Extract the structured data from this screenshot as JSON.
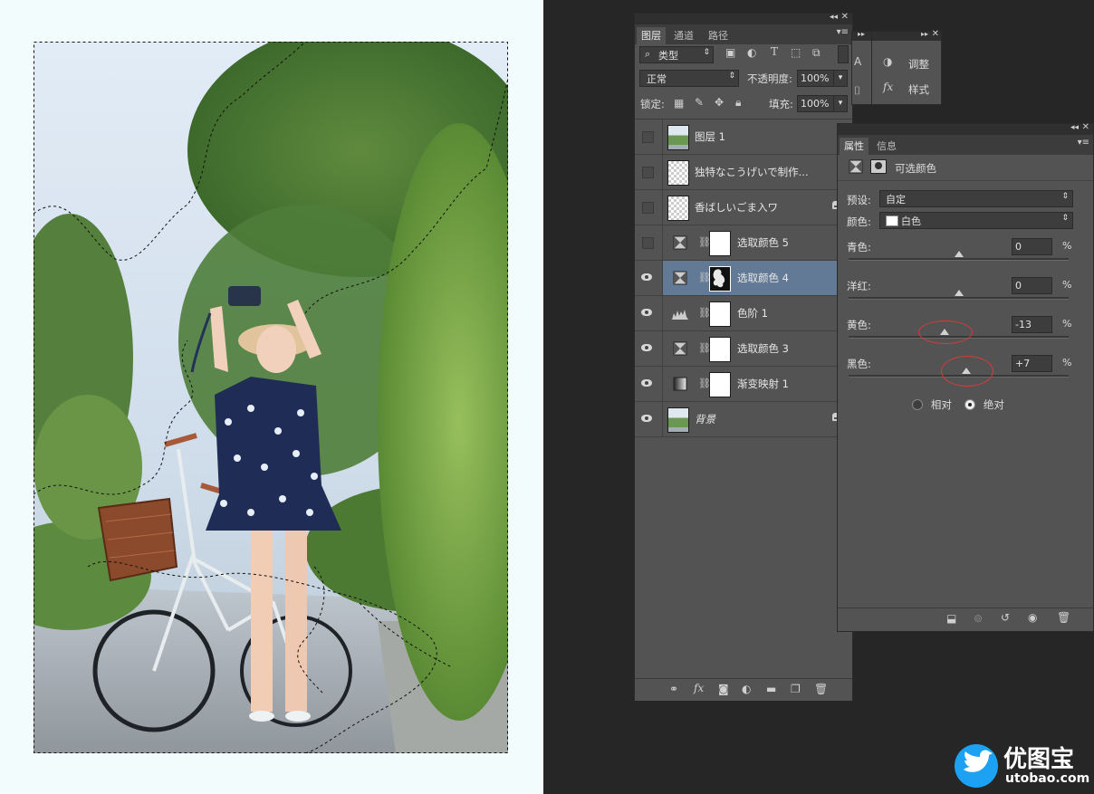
{
  "layers_panel": {
    "tabs": [
      "图层",
      "通道",
      "路径"
    ],
    "filter_kind": "类型",
    "blend_mode": "正常",
    "opacity_label": "不透明度:",
    "opacity_value": "100%",
    "lock_label": "锁定:",
    "fill_label": "填充:",
    "fill_value": "100%",
    "layers": [
      {
        "name": "图层 1",
        "visible": false,
        "thumb": "photo"
      },
      {
        "name": "独特なこうげいで制作...",
        "visible": false,
        "thumb": "checker"
      },
      {
        "name": "香ばしいごま入ワ",
        "visible": false,
        "thumb": "checker",
        "locked": true
      },
      {
        "name": "选取颜色 5",
        "visible": false,
        "thumb": "adjust-selective"
      },
      {
        "name": "选取颜色 4",
        "visible": true,
        "thumb": "adjust-selective",
        "selected": true
      },
      {
        "name": "色阶 1",
        "visible": true,
        "thumb": "adjust-levels"
      },
      {
        "name": "选取颜色 3",
        "visible": true,
        "thumb": "adjust-selective"
      },
      {
        "name": "渐变映射 1",
        "visible": true,
        "thumb": "adjust-gradient"
      },
      {
        "name": "背景",
        "visible": true,
        "thumb": "photo",
        "locked": true
      }
    ]
  },
  "adjust_panel": {
    "items": [
      {
        "label": "调整",
        "icon": "adjust-icon"
      },
      {
        "label": "样式",
        "icon": "fx-icon"
      }
    ]
  },
  "properties_panel": {
    "tabs": [
      "属性",
      "信息"
    ],
    "title": "可选颜色",
    "preset_label": "预设:",
    "preset_value": "自定",
    "color_label": "颜色:",
    "color_value": "白色",
    "sliders": [
      {
        "label": "青色:",
        "value": "0",
        "unit": "%",
        "position": 0.5
      },
      {
        "label": "洋红:",
        "value": "0",
        "unit": "%",
        "position": 0.5
      },
      {
        "label": "黄色:",
        "value": "-13",
        "unit": "%",
        "position": 0.435
      },
      {
        "label": "黑色:",
        "value": "+7",
        "unit": "%",
        "position": 0.535
      }
    ],
    "radio_relative": "相对",
    "radio_absolute": "绝对",
    "selected_mode": "absolute"
  },
  "watermark": {
    "brand_cn": "优图宝",
    "brand_url": "utobao.com"
  },
  "colors": {
    "selected_layer": "#627a95",
    "panel_bg": "#535353",
    "annotation_red": "#d83a3a"
  }
}
